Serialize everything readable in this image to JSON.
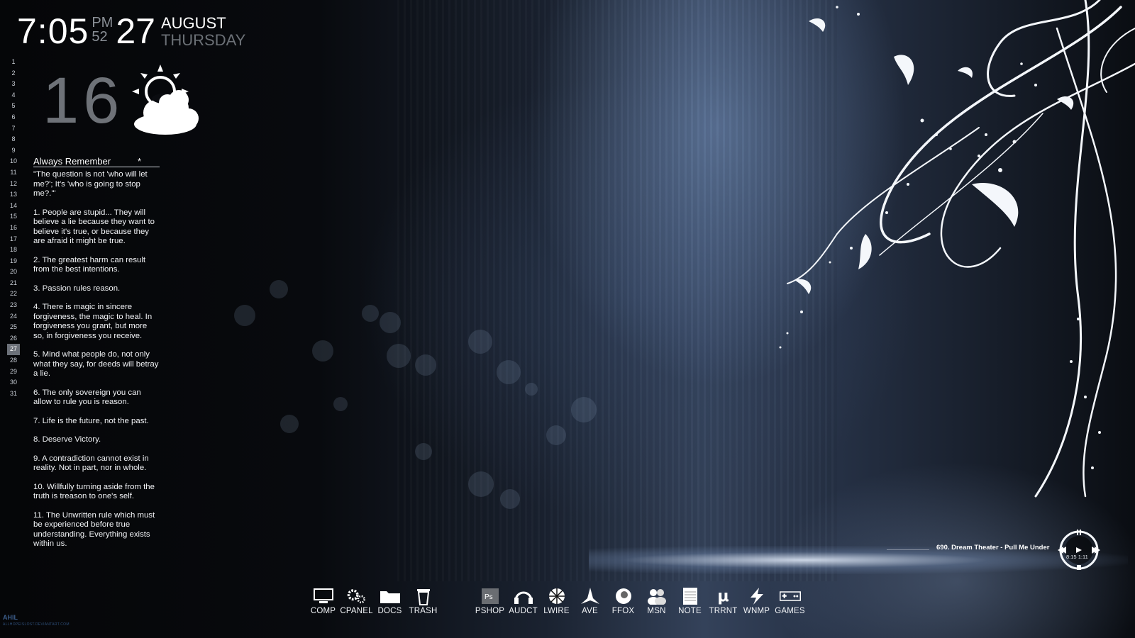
{
  "clock": {
    "time": "7:05",
    "ampm": "PM",
    "seconds": "52",
    "day": "27",
    "month": "AUGUST",
    "weekday": "THURSDAY"
  },
  "calendar": {
    "days": [
      "1",
      "2",
      "3",
      "4",
      "5",
      "6",
      "7",
      "8",
      "9",
      "10",
      "11",
      "12",
      "13",
      "14",
      "15",
      "16",
      "17",
      "18",
      "19",
      "20",
      "21",
      "22",
      "23",
      "24",
      "25",
      "26",
      "27",
      "28",
      "29",
      "30",
      "31"
    ],
    "today": "27"
  },
  "weather": {
    "temperature": "16",
    "icon": "partly-cloudy-icon"
  },
  "notes": {
    "title": "Always Remember",
    "marker": "*",
    "quote": "\"The question is not 'who will let me?'; It's 'who is going to stop me?.'\"",
    "items": [
      "1. People are stupid... They will believe a lie because they want to believe it's true, or because they are afraid it might be true.",
      "2. The greatest harm can result from the best intentions.",
      "3. Passion rules reason.",
      "4. There is magic in sincere forgiveness, the magic to heal. In forgiveness you grant, but more so, in forgiveness you receive.",
      "5. Mind what people do, not only what they say, for deeds will betray a lie.",
      "6. The only sovereign you can allow to rule you is reason.",
      "7. Life is the future, not the past.",
      "8. Deserve Victory.",
      "9. A contradiction cannot exist in reality. Not in part, nor in whole.",
      "10. Willfully turning aside from the truth is treason to one's self.",
      "11. The Unwritten rule which must be experienced before true understanding. Everything exists within us."
    ]
  },
  "dock_left": [
    {
      "label": "COMP",
      "icon": "monitor-icon"
    },
    {
      "label": "CPANEL",
      "icon": "gears-icon"
    },
    {
      "label": "DOCS",
      "icon": "folder-icon"
    },
    {
      "label": "TRASH",
      "icon": "trash-icon"
    }
  ],
  "dock_right": [
    {
      "label": "PSHOP",
      "icon": "photoshop-icon"
    },
    {
      "label": "AUDCT",
      "icon": "headphones-icon"
    },
    {
      "label": "LWIRE",
      "icon": "limewire-icon"
    },
    {
      "label": "AVE",
      "icon": "ave-icon"
    },
    {
      "label": "FFOX",
      "icon": "firefox-icon"
    },
    {
      "label": "MSN",
      "icon": "msn-icon"
    },
    {
      "label": "NOTE",
      "icon": "notepad-icon"
    },
    {
      "label": "TRRNT",
      "icon": "utorrent-icon"
    },
    {
      "label": "WNMP",
      "icon": "winamp-icon"
    },
    {
      "label": "GAMES",
      "icon": "gamepad-icon"
    }
  ],
  "music": {
    "track": "690. Dream Theater - Pull Me Under",
    "elapsed": "8:15",
    "total": "1:11"
  },
  "credit": {
    "name": "AHIL",
    "url": "ALLHOPEISLOST.DEVIANTART.COM"
  },
  "colors": {
    "accent": "#ffffff",
    "background": "#0a0d12",
    "glow": "#9fb3d3"
  }
}
